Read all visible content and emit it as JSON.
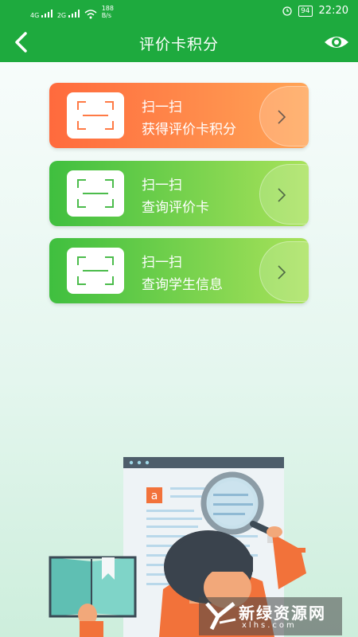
{
  "status_bar": {
    "signal1": "4G",
    "signal2": "2G",
    "net_speed_value": "188",
    "net_speed_unit": "B/s",
    "battery": "94",
    "time": "22:20"
  },
  "header": {
    "title": "评价卡积分"
  },
  "cards": [
    {
      "line1": "扫一扫",
      "line2": "获得评价卡积分"
    },
    {
      "line1": "扫一扫",
      "line2": "查询评价卡"
    },
    {
      "line1": "扫一扫",
      "line2": "查询学生信息"
    }
  ],
  "illustration": {
    "doc_badge": "a"
  },
  "watermark": {
    "name": "新绿资源网",
    "url": "xlhs.com"
  },
  "colors": {
    "header_green": "#1eaa3e",
    "card_orange_start": "#ff6a3d",
    "card_orange_end": "#ffa456",
    "card_green_start": "#3fbf3f",
    "card_green_end": "#a8e25a"
  }
}
